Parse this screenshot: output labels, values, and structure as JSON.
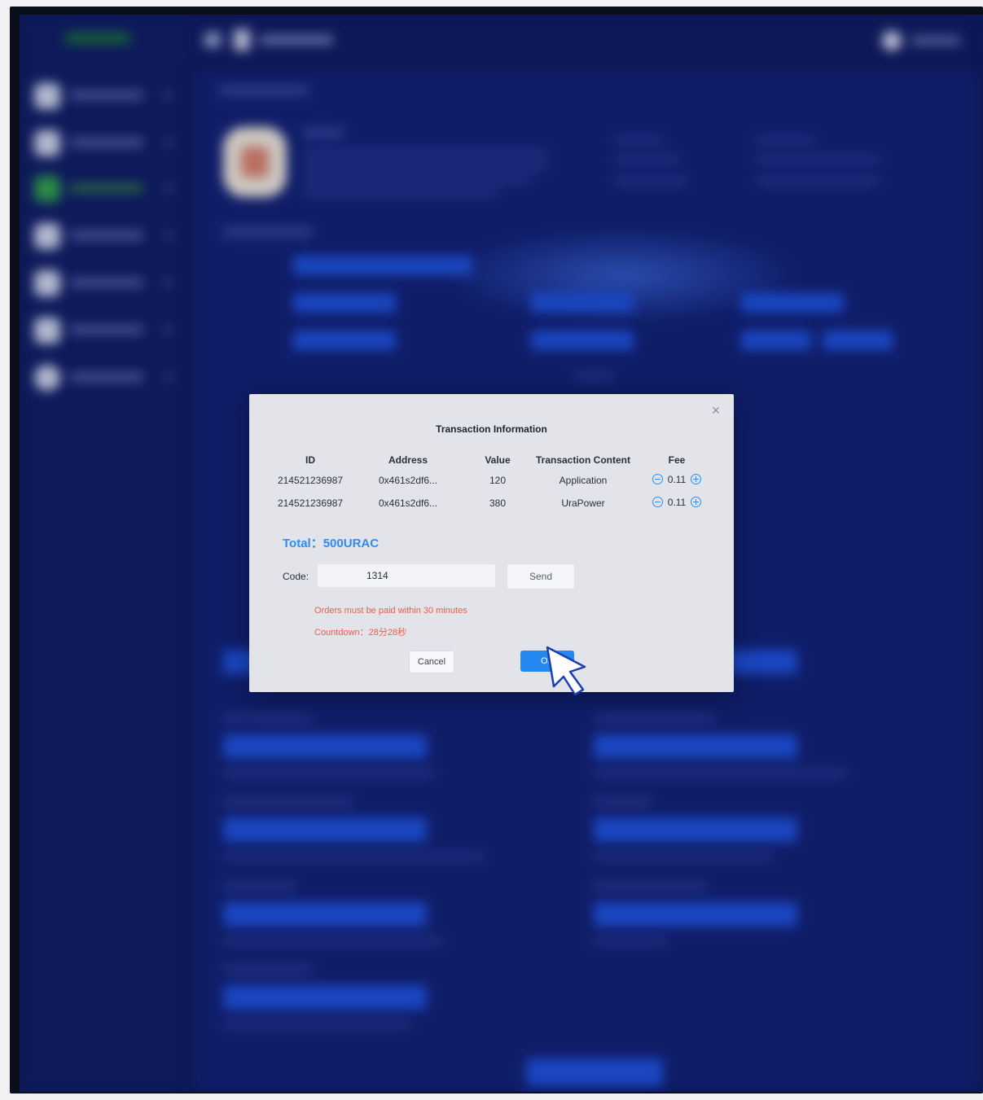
{
  "modal": {
    "title": "Transaction Information",
    "close_icon": "close-icon",
    "columns": [
      "ID",
      "Address",
      "Value",
      "Transaction Content",
      "Fee"
    ],
    "rows": [
      {
        "id": "214521236987",
        "address": "0x461s2df6...",
        "value": "120",
        "content": "Application",
        "fee": "0.11"
      },
      {
        "id": "214521236987",
        "address": "0x461s2df6...",
        "value": "380",
        "content": "UraPower",
        "fee": "0.11"
      }
    ],
    "total": "Total：500URAC",
    "code_label": "Code:",
    "code_value": "1314",
    "send_label": "Send",
    "warning": "Orders must be paid within 30 minutes",
    "countdown": "Countdown：28分28秒",
    "cancel_label": "Cancel",
    "ok_label": "OK"
  },
  "colors": {
    "accent": "#2f8cf0",
    "warning": "#ee5b4a",
    "background": "#112071"
  }
}
